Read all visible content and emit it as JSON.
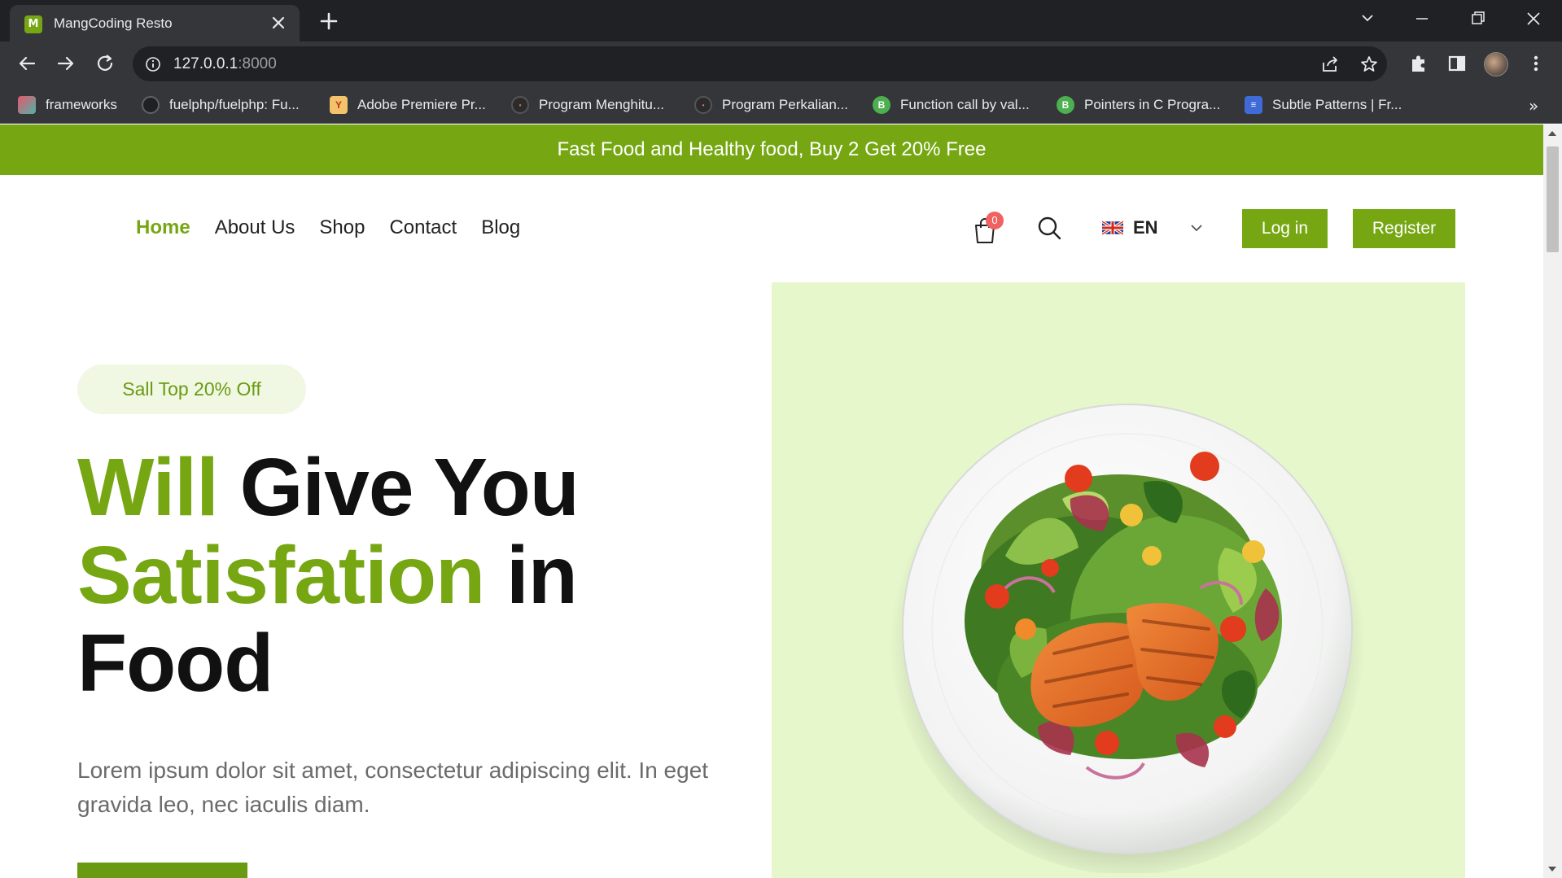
{
  "browser": {
    "tab_title": "MangCoding Resto",
    "url_host": "127.0.0.1",
    "url_port": ":8000",
    "bookmarks": [
      {
        "label": "frameworks",
        "icon": "layers-icon"
      },
      {
        "label": "fuelphp/fuelphp: Fu...",
        "icon": "github-icon"
      },
      {
        "label": "Adobe Premiere Pr...",
        "icon": "y-icon"
      },
      {
        "label": "Program Menghitu...",
        "icon": "site-icon"
      },
      {
        "label": "Program Perkalian...",
        "icon": "site-icon"
      },
      {
        "label": "Function call by val...",
        "icon": "b-icon"
      },
      {
        "label": "Pointers in C Progra...",
        "icon": "b-icon"
      },
      {
        "label": "Subtle Patterns | Fr...",
        "icon": "pattern-icon"
      }
    ],
    "bookmarks_more": "»"
  },
  "page": {
    "promo_text": "Fast Food and Healthy food, Buy 2 Get 20% Free",
    "nav": [
      {
        "label": "Home",
        "active": true
      },
      {
        "label": "About Us",
        "active": false
      },
      {
        "label": "Shop",
        "active": false
      },
      {
        "label": "Contact",
        "active": false
      },
      {
        "label": "Blog",
        "active": false
      }
    ],
    "cart_count": "0",
    "language": "EN",
    "login_label": "Log in",
    "register_label": "Register",
    "sale_badge": "Sall Top 20% Off",
    "hero": {
      "w1": "Will",
      "w2": " Give You",
      "w3": "Satisfation",
      "w4": " in",
      "w5": "Food"
    },
    "description": "Lorem ipsum dolor sit amet, consectetur adipiscing elit. In eget gravida leo, nec iaculis diam.",
    "colors": {
      "brand_green": "#76a713",
      "hero_bg": "#e6f7cc",
      "sale_bg": "#f0f8e3"
    }
  }
}
